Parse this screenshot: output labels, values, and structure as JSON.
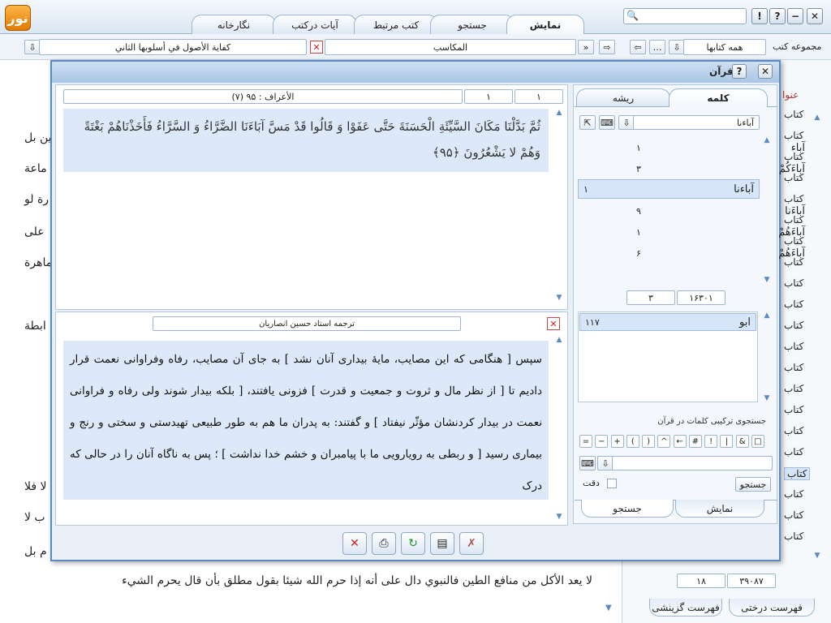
{
  "app": {
    "logo_text": "نور"
  },
  "tabs": [
    "نمایش",
    "جستجو",
    "کتب مرتبط",
    "آیات درکتب",
    "نگارخانه"
  ],
  "window_buttons": {
    "help2": "?",
    "help": "!"
  },
  "row2": {
    "book_title": "كفاية الأصول في أسلوبها الثاني",
    "section": "المكاسب",
    "collection_select": "همه كتابها",
    "collection_label": "مجموعه كتب"
  },
  "background_doc": {
    "lines": [
      "ين بل",
      "ماعة",
      "رة لو",
      "على",
      "ماهرة",
      "ابطة",
      "لا فلا",
      "ب لا",
      "م بل",
      "لا يعد الأكل من منافع الطين فالنبوي دال على أنه إذا حرم الله  شيئا بقول مطلق بأن قال يحرم الشيء"
    ],
    "right_label": "عنوا",
    "kitab_items": [
      "كتاب",
      "كتاب",
      "كتاب",
      "كتاب",
      "كتاب",
      "كتاب",
      "كتاب",
      "كتاب",
      "كتاب",
      "كتاب",
      "كتاب",
      "كتاب",
      "كتاب",
      "كتاب",
      "كتاب",
      "كتاب",
      "كتاب",
      "كتاب",
      "كتاب",
      "كتاب",
      "كتاب"
    ],
    "page_field": "۱۸",
    "total_field": "۳۹۰۸۷",
    "bottom_tabs": [
      "فهرست درختی",
      "فهرست گزینشی"
    ]
  },
  "dialog": {
    "title": "قرآن",
    "verse_page": "۱",
    "verse_index": "۱",
    "verse_sura": "(۷) الأعراف : ۹۵",
    "verse_text": "ثُمَّ بَدَّلْنَا مَكَانَ السَّيِّئَةِ الْحَسَنَةَ حَتَّى عَفَوْا وَ قَالُوا قَدْ مَسَّ آبَاءَنَا الضَّرَّاءُ وَ السَّرَّاءُ فَأَخَذْنَاهُمْ بَغْتَةً وَهُمْ لا يَشْعُرُونَ ﴿۹۵﴾",
    "translator": "ترجمه استاد حسين انصاريان",
    "translation": "سپس [ هنگامی که این مصایب، مایهٔ بیداری آنان نشد ] به جای آن مصایب، رفاه وفراوانی نعمت قرار دادیم تا [ از نظر مال و ثروت و جمعیت و قدرت ] فزونی یافتند، [ بلکه بیدار شوند ولی رفاه و فراوانی نعمت در بیدار کردنشان مؤثّر نیفتاد ] و گفتند: به پدران ما هم به طور طبیعی تهیدستی و سختی و رنج و بیماری رسید [ و ربطی به رویارویی ما با پیامبران و خشم خدا نداشت ] ؛ پس به ناگاه آنان را در حالی که درک",
    "side_tabs": {
      "word": "كلمه",
      "root": "ريشه"
    },
    "word_input": "آباءنا",
    "words": [
      {
        "word": "آباء",
        "count": "۱"
      },
      {
        "word": "آباءَكُمْ",
        "count": "۳"
      },
      {
        "word": "آباءنا",
        "count": "۱"
      },
      {
        "word": "آباءَنا",
        "count": "۹"
      },
      {
        "word": "آباءَهُمْ",
        "count": "۱"
      },
      {
        "word": "آباءَهُمْ",
        "count": "۶"
      }
    ],
    "word_counter_left": "۳",
    "word_counter_right": "۱۶۳۰۱",
    "root_word": "ابو",
    "root_count": "۱۱۷",
    "combo_label": "جستجوی ترکیبی کلمات در قرآن",
    "operators": [
      "□",
      "&",
      "|",
      "!",
      "#",
      "←",
      "^",
      ")",
      "(",
      "+",
      "−",
      "="
    ],
    "search_button": "جستجو",
    "exact_label": "دقت",
    "bottom_tabs": {
      "show": "نمایش",
      "search": "جستجو"
    }
  }
}
